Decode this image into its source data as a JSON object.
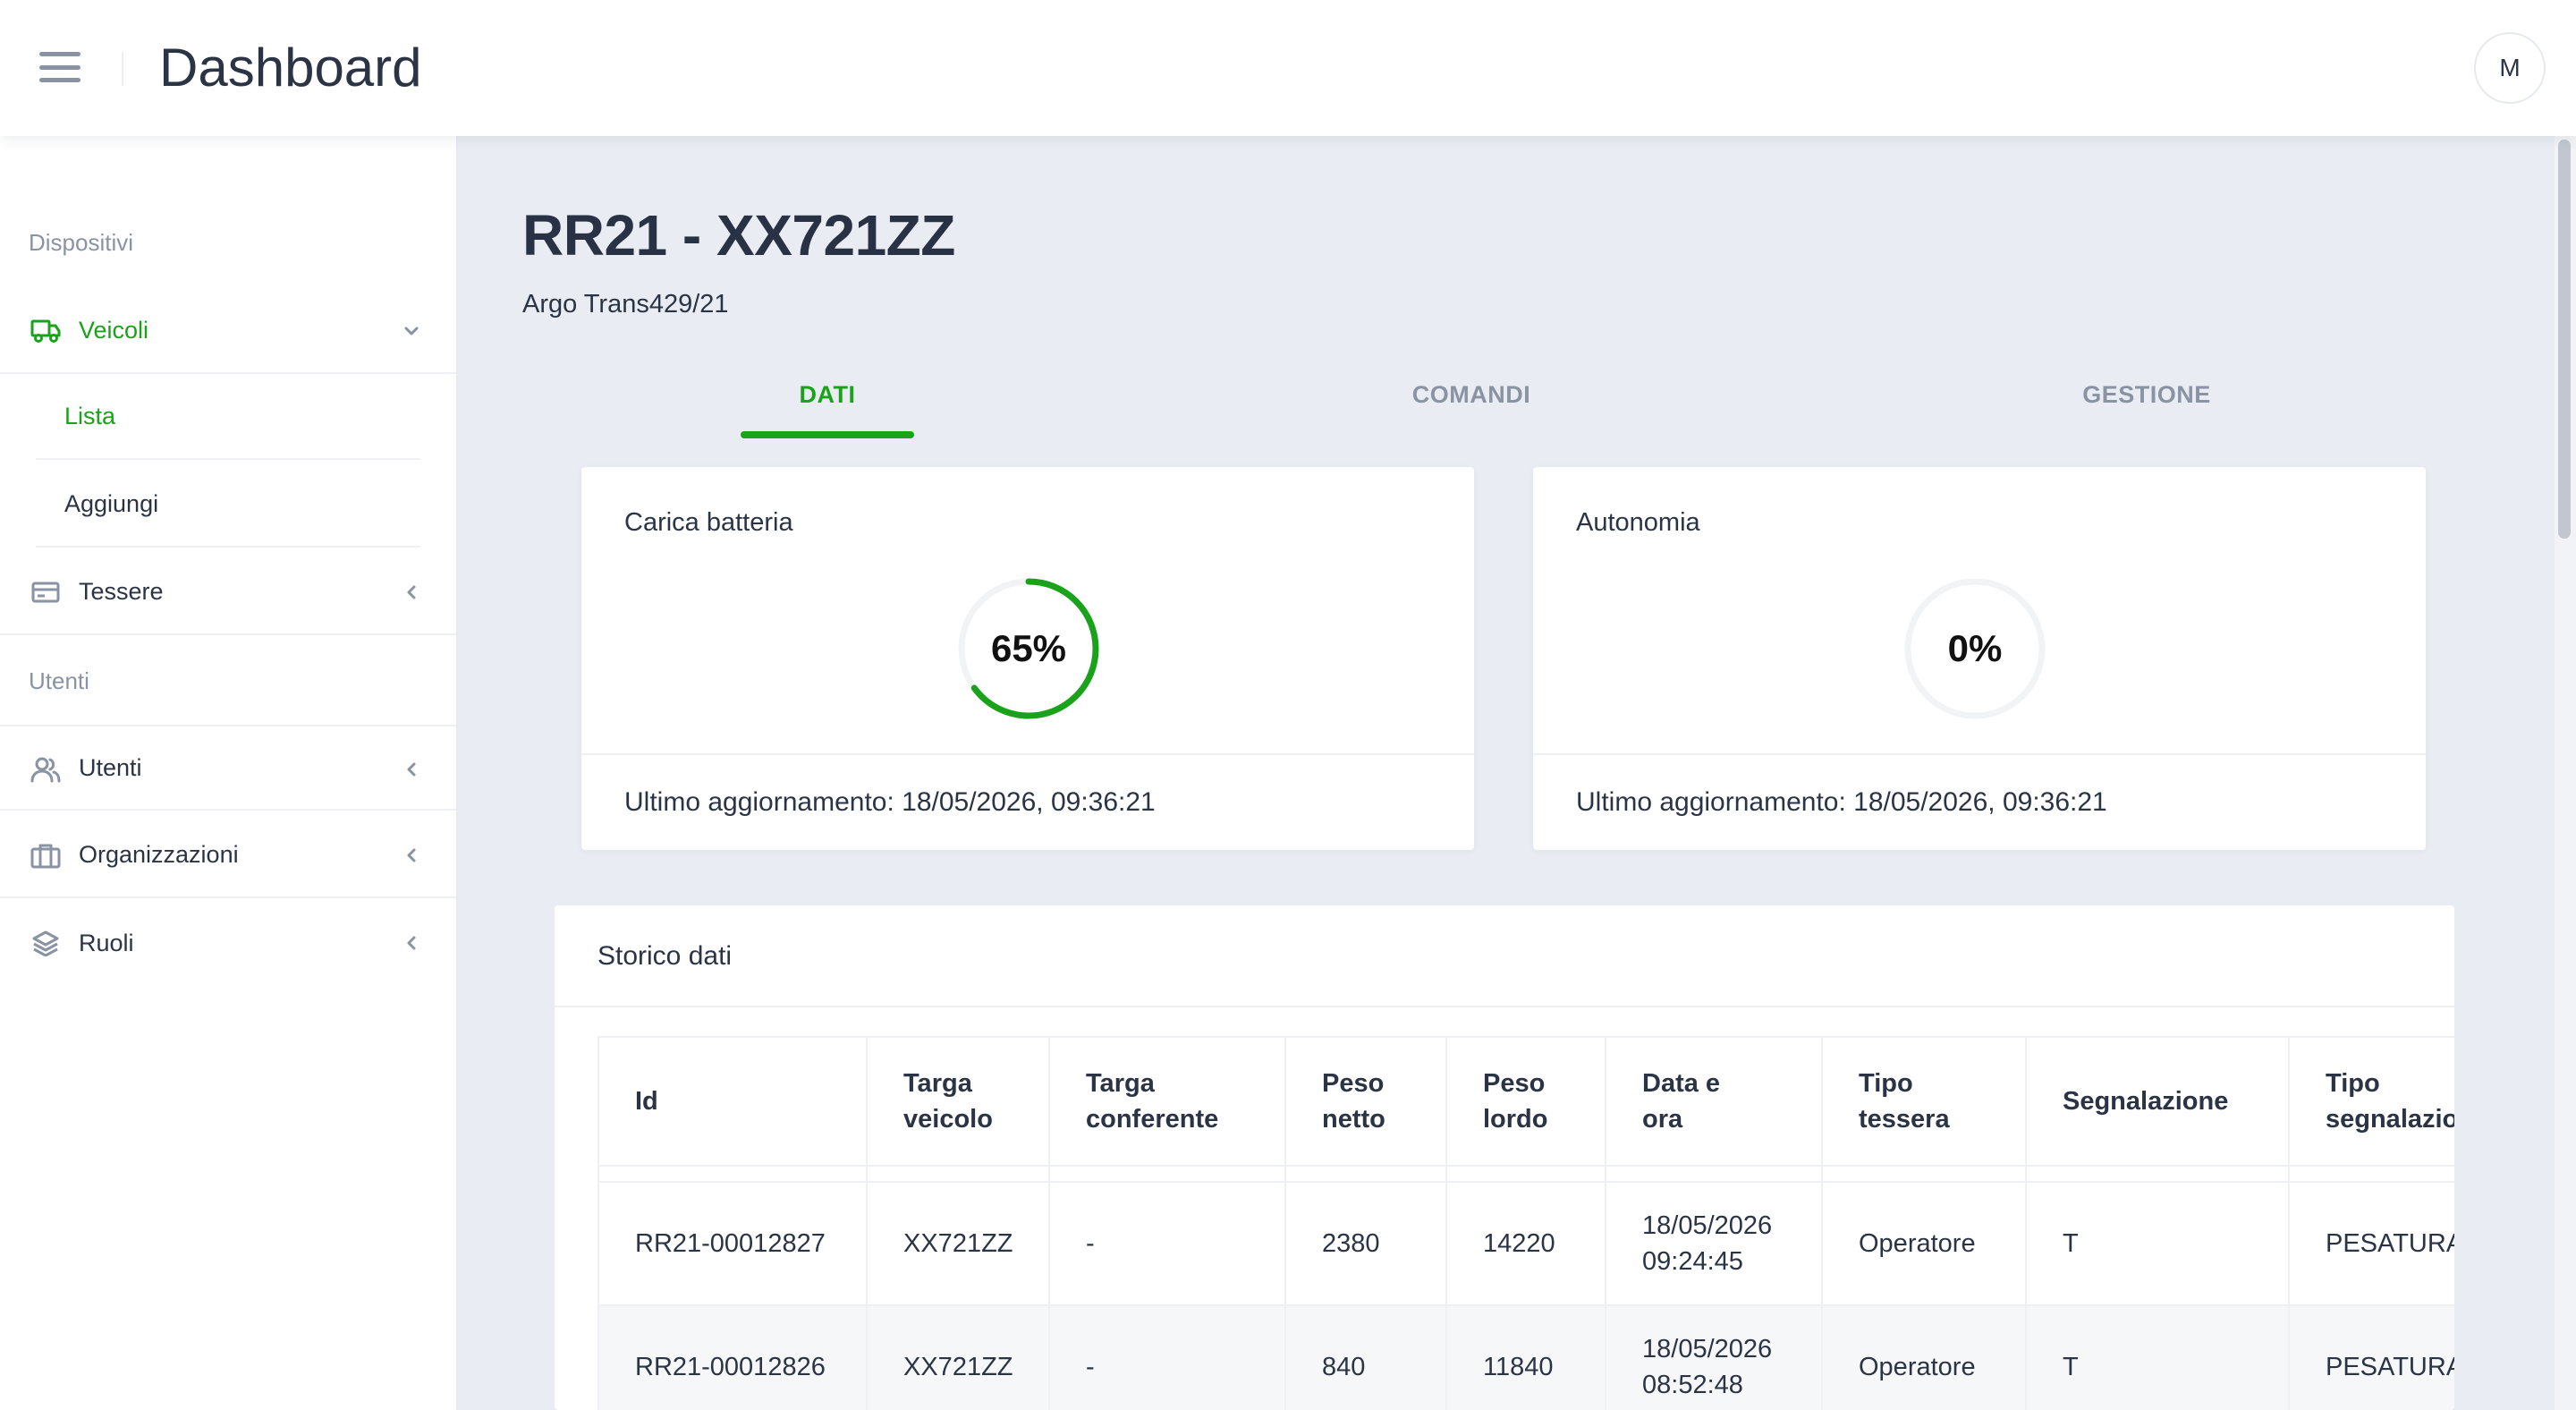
{
  "header": {
    "title": "Dashboard",
    "avatar_initial": "M"
  },
  "sidebar": {
    "section_devices": "Dispositivi",
    "vehicles": "Veicoli",
    "vehicles_list": "Lista",
    "vehicles_add": "Aggiungi",
    "cards": "Tessere",
    "section_users": "Utenti",
    "users": "Utenti",
    "organizations": "Organizzazioni",
    "roles": "Ruoli"
  },
  "vehicle": {
    "title": "RR21 - XX721ZZ",
    "subtitle": "Argo Trans429/21"
  },
  "tabs": {
    "data": "DATI",
    "commands": "COMANDI",
    "management": "GESTIONE"
  },
  "battery": {
    "title": "Carica batteria",
    "value_text": "65%",
    "percent": 65,
    "updated": "Ultimo aggiornamento: 18/05/2026, 09:36:21"
  },
  "autonomy": {
    "title": "Autonomia",
    "value_text": "0%",
    "percent": 0,
    "updated": "Ultimo aggiornamento: 18/05/2026, 09:36:21"
  },
  "history": {
    "title": "Storico dati",
    "columns": {
      "id": "Id",
      "plate_l1": "Targa",
      "plate_l2": "veicolo",
      "conferrer_l1": "Targa",
      "conferrer_l2": "conferente",
      "net_l1": "Peso",
      "net_l2": "netto",
      "gross_l1": "Peso",
      "gross_l2": "lordo",
      "datetime_l1": "Data e",
      "datetime_l2": "ora",
      "cardtype_l1": "Tipo",
      "cardtype_l2": "tessera",
      "report": "Segnalazione",
      "reporttype_l1": "Tipo",
      "reporttype_l2": "segnalazione"
    },
    "rows": [
      {
        "id": "RR21-00012827",
        "plate": "XX721ZZ",
        "conferrer": "-",
        "net": "2380",
        "gross": "14220",
        "date": "18/05/2026",
        "time": "09:24:45",
        "card_type": "Operatore",
        "report": "T",
        "report_type": "PESATURA"
      },
      {
        "id": "RR21-00012826",
        "plate": "XX721ZZ",
        "conferrer": "-",
        "net": "840",
        "gross": "11840",
        "date": "18/05/2026",
        "time": "08:52:48",
        "card_type": "Operatore",
        "report": "T",
        "report_type": "PESATURA"
      }
    ]
  },
  "colors": {
    "accent": "#1aa31a",
    "muted": "#8a93a3",
    "text": "#2b3445",
    "background": "#e9edf3"
  }
}
